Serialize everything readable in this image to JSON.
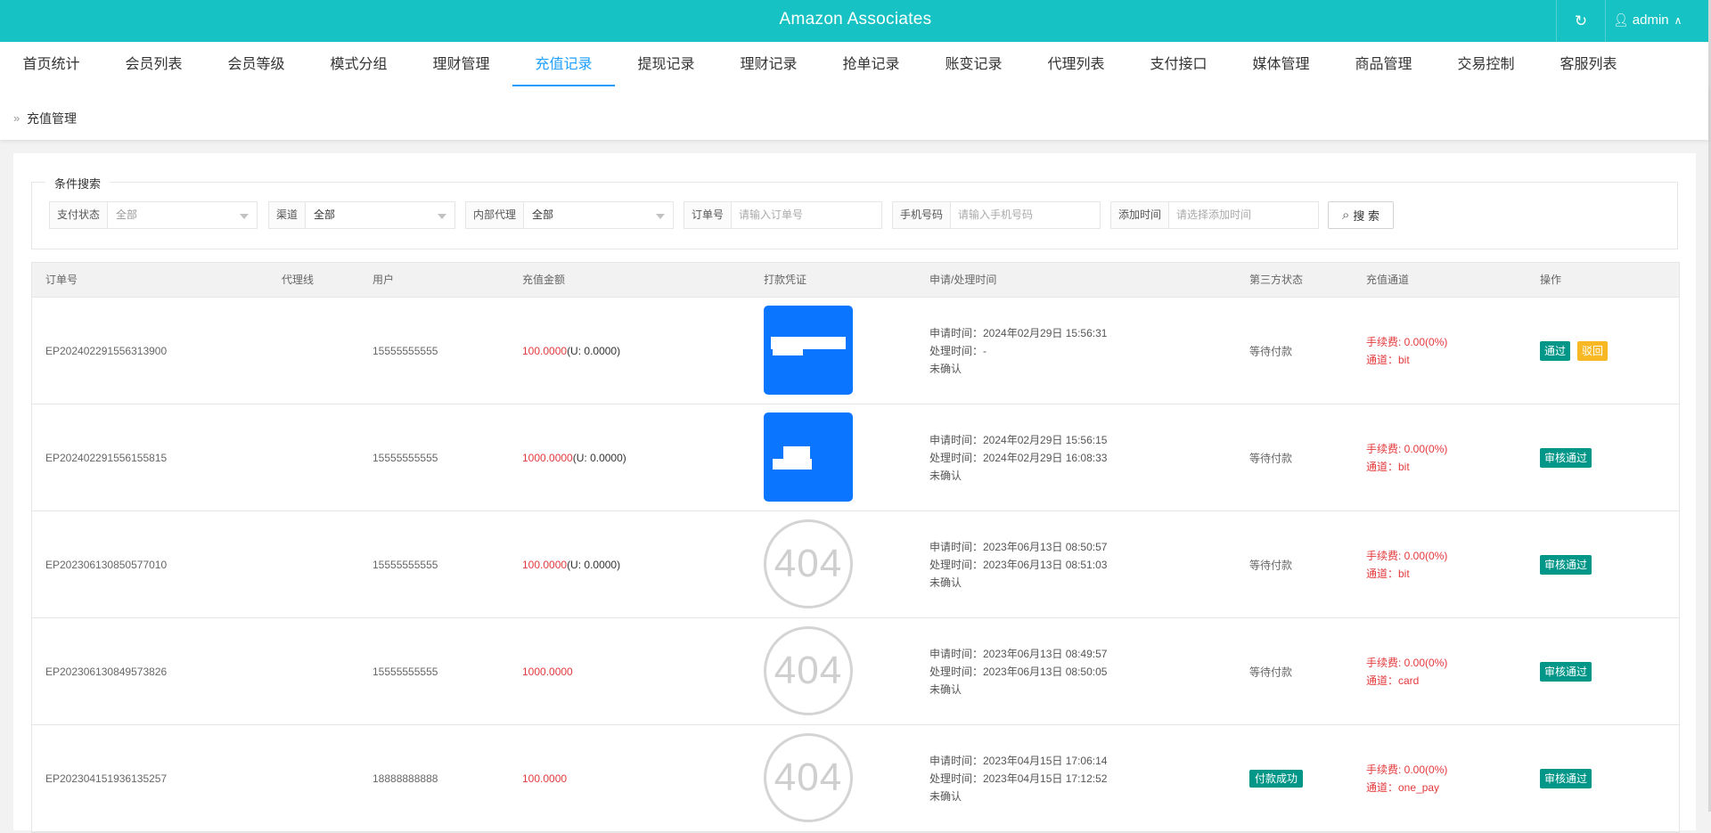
{
  "header": {
    "title": "Amazon Associates",
    "refresh_icon": "refresh-icon",
    "user_icon": "user-icon",
    "user_name": "admin",
    "chevron": "chevron-up-icon"
  },
  "nav": {
    "items": [
      "首页统计",
      "会员列表",
      "会员等级",
      "模式分组",
      "理财管理",
      "充值记录",
      "提现记录",
      "理财记录",
      "抢单记录",
      "账变记录",
      "代理列表",
      "支付接口",
      "媒体管理",
      "商品管理",
      "交易控制",
      "客服列表"
    ],
    "active_index": 5
  },
  "breadcrumb": {
    "label": "充值管理"
  },
  "search": {
    "legend": "条件搜索",
    "pay_status_label": "支付状态",
    "pay_status_value": "全部",
    "channel_label": "渠道",
    "channel_value": "全部",
    "agent_label": "内部代理",
    "agent_value": "全部",
    "order_label": "订单号",
    "order_placeholder": "请输入订单号",
    "phone_label": "手机号码",
    "phone_placeholder": "请输入手机号码",
    "time_label": "添加时间",
    "time_placeholder": "请选择添加时间",
    "button_label": "搜 索"
  },
  "table": {
    "columns": [
      "订单号",
      "代理线",
      "用户",
      "充值金额",
      "打款凭证",
      "申请/处理时间",
      "第三方状态",
      "充值通道",
      "操作"
    ],
    "rows": [
      {
        "order": "EP202402291556313900",
        "agent": "",
        "user": "15555555555",
        "amount": "100.0000",
        "usdt": "(U: 0.0000)",
        "voucher": "image",
        "apply": "申请时间：2024年02月29日 15:56:31",
        "process": "处理时间：-",
        "confirm": "未确认",
        "status": "等待付款",
        "status_badge": false,
        "fee": "手续费: 0.00(0%)",
        "channel": "通道：bit",
        "actions": [
          "通过",
          "驳回"
        ]
      },
      {
        "order": "EP202402291556155815",
        "agent": "",
        "user": "15555555555",
        "amount": "1000.0000",
        "usdt": "(U: 0.0000)",
        "voucher": "image",
        "apply": "申请时间：2024年02月29日 15:56:15",
        "process": "处理时间：2024年02月29日 16:08:33",
        "confirm": "未确认",
        "status": "等待付款",
        "status_badge": false,
        "fee": "手续费: 0.00(0%)",
        "channel": "通道：bit",
        "actions": [
          "审核通过"
        ]
      },
      {
        "order": "EP202306130850577010",
        "agent": "",
        "user": "15555555555",
        "amount": "100.0000",
        "usdt": "(U: 0.0000)",
        "voucher": "404",
        "apply": "申请时间：2023年06月13日 08:50:57",
        "process": "处理时间：2023年06月13日 08:51:03",
        "confirm": "未确认",
        "status": "等待付款",
        "status_badge": false,
        "fee": "手续费: 0.00(0%)",
        "channel": "通道：bit",
        "actions": [
          "审核通过"
        ]
      },
      {
        "order": "EP202306130849573826",
        "agent": "",
        "user": "15555555555",
        "amount": "1000.0000",
        "usdt": "",
        "voucher": "404",
        "apply": "申请时间：2023年06月13日 08:49:57",
        "process": "处理时间：2023年06月13日 08:50:05",
        "confirm": "未确认",
        "status": "等待付款",
        "status_badge": false,
        "fee": "手续费: 0.00(0%)",
        "channel": "通道：card",
        "actions": [
          "审核通过"
        ]
      },
      {
        "order": "EP202304151936135257",
        "agent": "",
        "user": "18888888888",
        "amount": "100.0000",
        "usdt": "",
        "voucher": "404",
        "apply": "申请时间：2023年04月15日 17:06:14",
        "process": "处理时间：2023年04月15日 17:12:52",
        "confirm": "未确认",
        "status": "付款成功",
        "status_badge": true,
        "fee": "手续费: 0.00(0%)",
        "channel": "通道：one_pay",
        "actions": [
          "审核通过"
        ]
      }
    ]
  },
  "colors": {
    "header_bg": "#16c2c3",
    "active_nav": "#1e9fff",
    "amount_red": "#e4393c",
    "badge_green": "#009688",
    "reject_yellow": "#f7b824",
    "voucher_blue": "#0a75ff"
  }
}
